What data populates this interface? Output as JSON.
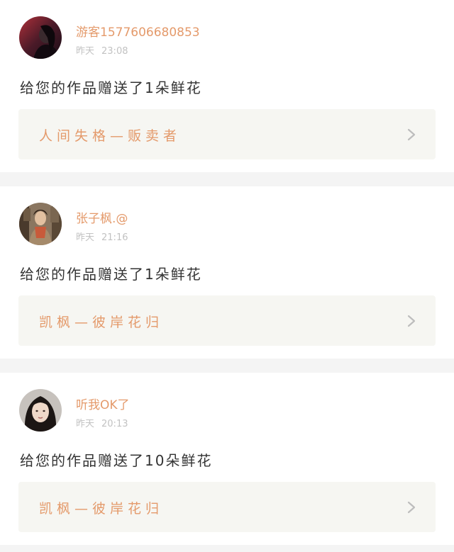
{
  "notifications": [
    {
      "username": "游客1577606680853",
      "time_day": "昨天",
      "time": "23:08",
      "message": "给您的作品赠送了1朵鲜花",
      "work_title": "人间失格—贩卖者",
      "avatar_icon": "dark-portrait-avatar"
    },
    {
      "username": "张子枫.@",
      "time_day": "昨天",
      "time": "21:16",
      "message": "给您的作品赠送了1朵鲜花",
      "work_title": "凯枫—彼岸花归",
      "avatar_icon": "scarf-portrait-avatar"
    },
    {
      "username": "听我OK了",
      "time_day": "昨天",
      "time": "20:13",
      "message": "给您的作品赠送了10朵鲜花",
      "work_title": "凯枫—彼岸花归",
      "avatar_icon": "girl-portrait-avatar"
    }
  ],
  "colors": {
    "accent": "#e49a6b",
    "card_bg": "#ffffff",
    "page_bg": "#f4f4f4",
    "link_bg": "#f6f6f2",
    "muted": "#c2c2c2",
    "text": "#333333"
  }
}
